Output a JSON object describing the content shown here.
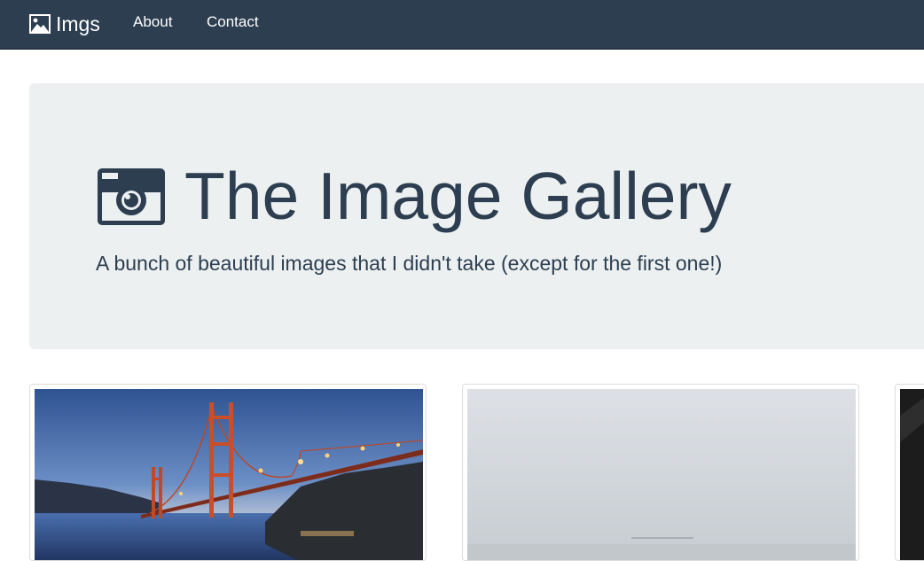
{
  "navbar": {
    "brand_icon": "picture-icon",
    "brand_label": "Imgs",
    "links": [
      {
        "label": "About"
      },
      {
        "label": "Contact"
      }
    ],
    "background": "#2c3e50"
  },
  "hero": {
    "icon": "camera-icon",
    "title": "The Image Gallery",
    "subtitle": "A bunch of beautiful images that I didn't take (except for the first one!)",
    "background": "#ecf0f1",
    "text_color": "#2c3e50"
  },
  "gallery": {
    "thumbnails": [
      {
        "subject": "golden-gate-bridge-at-dusk"
      },
      {
        "subject": "foggy-gray-landscape"
      },
      {
        "subject": "dark-image-partially-visible"
      }
    ]
  }
}
